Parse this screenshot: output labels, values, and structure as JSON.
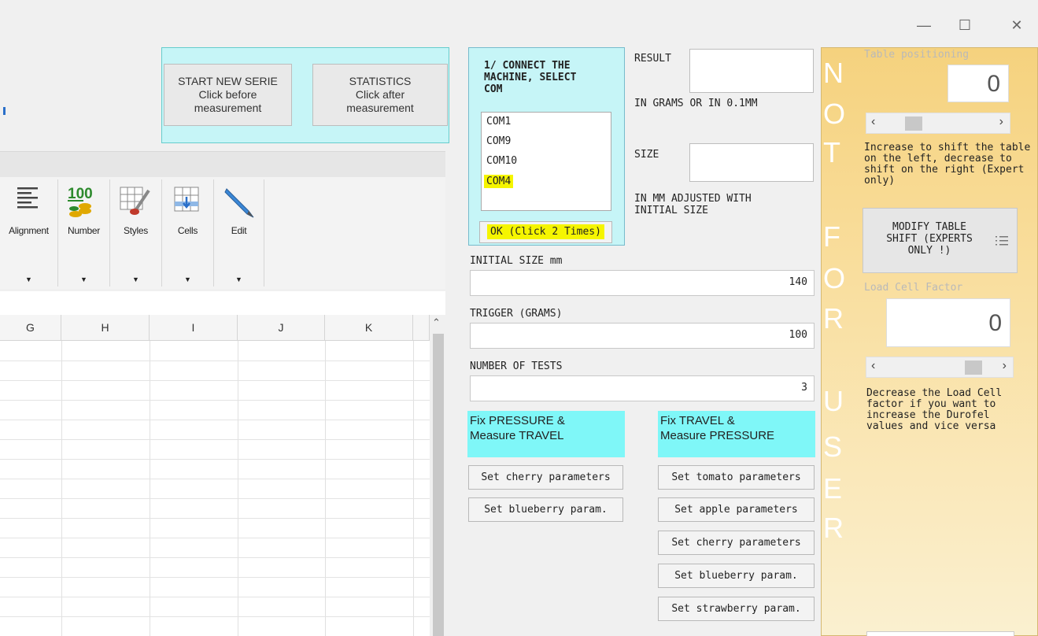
{
  "window": {
    "minimize_icon": "minimize",
    "maximize_icon": "maximize",
    "close_icon": "close"
  },
  "buttons_top": {
    "start_new_serie": [
      "START NEW SERIE",
      "Click before",
      "measurement"
    ],
    "statistics": [
      "STATISTICS",
      "Click after",
      "measurement"
    ]
  },
  "ribbon": {
    "groups": [
      {
        "label": "Alignment",
        "icon": "alignment-icon"
      },
      {
        "label": "Number",
        "icon": "number-icon"
      },
      {
        "label": "Styles",
        "icon": "styles-icon"
      },
      {
        "label": "Cells",
        "icon": "cells-icon"
      },
      {
        "label": "Edit",
        "icon": "edit-icon"
      }
    ],
    "number_icon_text": "100"
  },
  "spreadsheet": {
    "columns": [
      "G",
      "H",
      "I",
      "J",
      "K"
    ]
  },
  "connect": {
    "title": [
      "1/ CONNECT THE",
      "MACHINE, SELECT",
      "COM"
    ],
    "com_items": [
      "COM1",
      "COM9",
      "COM10",
      "COM4"
    ],
    "selected": "COM4",
    "ok_label": "OK (Click 2 Times)"
  },
  "result": {
    "label": "RESULT",
    "unit": "IN GRAMS OR IN 0.1MM",
    "size_label": "SIZE",
    "size_note": [
      "IN MM ADJUSTED WITH",
      "INITIAL SIZE"
    ]
  },
  "inputs": {
    "initial_size_label": "INITIAL SIZE mm",
    "initial_size_value": "140",
    "trigger_label": "TRIGGER (GRAMS)",
    "trigger_value": "100",
    "tests_label": "NUMBER OF TESTS",
    "tests_value": "3"
  },
  "modes": {
    "fix_pressure": [
      "Fix PRESSURE &",
      "Measure TRAVEL"
    ],
    "fix_travel": [
      "Fix TRAVEL &",
      "Measure PRESSURE"
    ]
  },
  "param_buttons_left": [
    "Set cherry parameters",
    "Set blueberry param."
  ],
  "param_buttons_right": [
    "Set tomato parameters",
    "Set apple parameters",
    "Set cherry parameters",
    "Set blueberry param.",
    "Set strawberry param."
  ],
  "expert": {
    "watermark_letters": [
      "N",
      "O",
      "T",
      "F",
      "O",
      "R",
      "U",
      "S",
      "E",
      "R"
    ],
    "table_positioning_label": "Table positioning",
    "table_positioning_value": "0",
    "table_positioning_slider": 0.2,
    "table_help": [
      "Increase to shift the table",
      "on the left, decrease to",
      "shift on the right (Expert",
      "only)"
    ],
    "modify_btn": [
      "MODIFY TABLE",
      "SHIFT (EXPERTS",
      "ONLY !)"
    ],
    "load_cell_label": "Load Cell Factor",
    "load_cell_value": "0",
    "load_cell_slider": 0.8,
    "load_cell_help": [
      "Decrease the Load Cell",
      "factor if you want to",
      "increase the Durofel",
      "values and vice versa"
    ]
  },
  "colors": {
    "cyan_panel": "#c6f5f7",
    "cyan_label": "#7ff7f8",
    "highlight": "#f5f500",
    "orange_panel": "#f5d27e"
  }
}
